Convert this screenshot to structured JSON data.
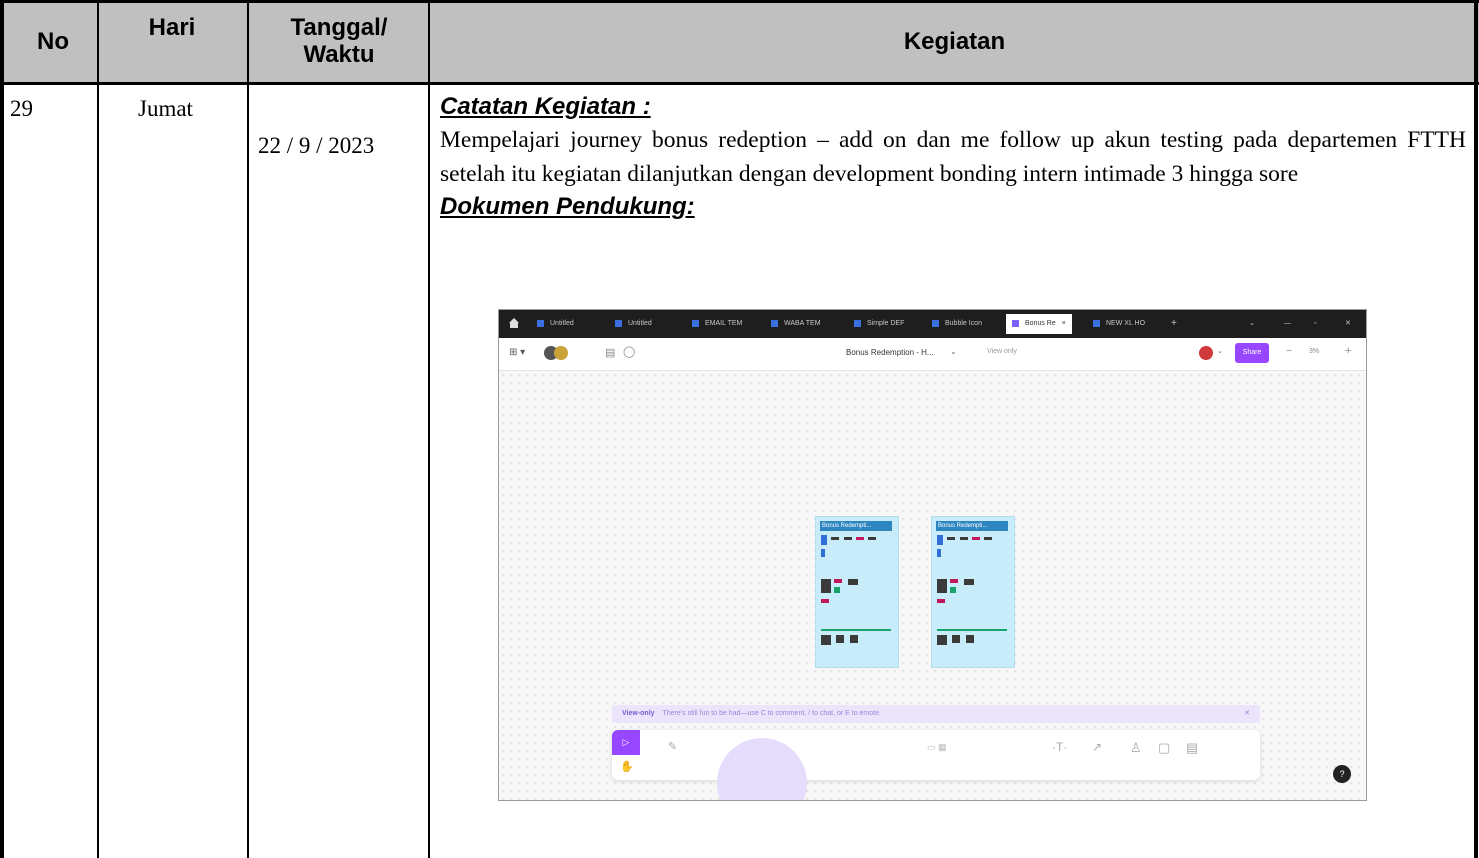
{
  "header": {
    "no": "No",
    "hari": "Hari",
    "tanggal_line1": "Tanggal/",
    "tanggal_line2": "Waktu",
    "kegiatan": "Kegiatan"
  },
  "row": {
    "no": "29",
    "hari": "Jumat",
    "tanggal": "22 / 9 / 2023",
    "catatan_heading": "Catatan Kegiatan :",
    "catatan_text": "Mempelajari journey bonus redeption – add on dan me follow up akun testing pada departemen FTTH setelah itu kegiatan dilanjutkan dengan development bonding intern intimade 3 hingga sore",
    "dokumen_heading": "Dokumen Pendukung:"
  },
  "screenshot": {
    "tabs": [
      "Untitled",
      "Untitled",
      "EMAIL TEM",
      "WABA TEM",
      "Simple DEF",
      "Bubble Icon",
      "Bonus Re",
      "NEW XL HO"
    ],
    "active_tab_index": 6,
    "toolbar": {
      "file_title": "Bonus Redemption - H...",
      "view_only": "View only",
      "share_label": "Share",
      "zoom": "3%"
    },
    "boards": [
      {
        "title": "Bonus Redempti..."
      },
      {
        "title": "Bonus Redempti..."
      }
    ],
    "notice": {
      "badge": "View-only",
      "text": "There's still fun to be had—use  C  to comment,  /  to chat, or  E  to emote."
    },
    "help_label": "?",
    "colors": {
      "accent": "#9747ff",
      "board_fill": "#c9ecfa",
      "tabbar": "#1e1e1e"
    }
  }
}
